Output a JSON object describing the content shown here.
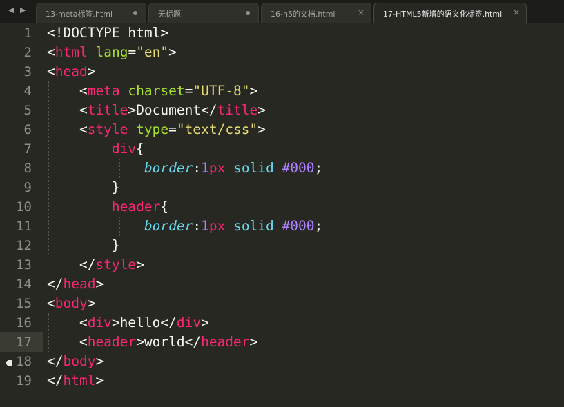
{
  "tabs": [
    {
      "title": "13-meta标签.html",
      "state": "modified"
    },
    {
      "title": "无标题",
      "state": "modified"
    },
    {
      "title": "16-h5的文档.html",
      "state": "close"
    },
    {
      "title": "17-HTML5新增的语义化标签.html",
      "state": "active-close"
    }
  ],
  "nav": {
    "left_glyph": "◀",
    "right_glyph": "▶"
  },
  "editor": {
    "current_line": "17",
    "lines": [
      {
        "num": "1",
        "text": "<!DOCTYPE html>"
      },
      {
        "num": "2",
        "text": "<html lang=\"en\">"
      },
      {
        "num": "3",
        "text": "<head>"
      },
      {
        "num": "4",
        "text": "    <meta charset=\"UTF-8\">"
      },
      {
        "num": "5",
        "text": "    <title>Document</title>"
      },
      {
        "num": "6",
        "text": "    <style type=\"text/css\">"
      },
      {
        "num": "7",
        "text": "        div{"
      },
      {
        "num": "8",
        "text": "            border:1px solid #000;"
      },
      {
        "num": "9",
        "text": "        }"
      },
      {
        "num": "10",
        "text": "        header{"
      },
      {
        "num": "11",
        "text": "            border:1px solid #000;"
      },
      {
        "num": "12",
        "text": "        }"
      },
      {
        "num": "13",
        "text": "    </style>"
      },
      {
        "num": "14",
        "text": "</head>"
      },
      {
        "num": "15",
        "text": "<body>"
      },
      {
        "num": "16",
        "text": "    <div>hello</div>"
      },
      {
        "num": "17",
        "text": "    <header>world</header>"
      },
      {
        "num": "18",
        "text": "</body>"
      },
      {
        "num": "19",
        "text": "</html>"
      }
    ]
  },
  "theme": {
    "background": "#272822",
    "tag": "#f92672",
    "attribute": "#a6e22e",
    "string": "#e6db74",
    "number": "#ae81ff",
    "property": "#66d9ef",
    "text": "#f8f8f2"
  },
  "icons": [
    "bookmark-icon",
    "close-icon",
    "modified-dot-icon",
    "nav-left-icon",
    "nav-right-icon"
  ]
}
